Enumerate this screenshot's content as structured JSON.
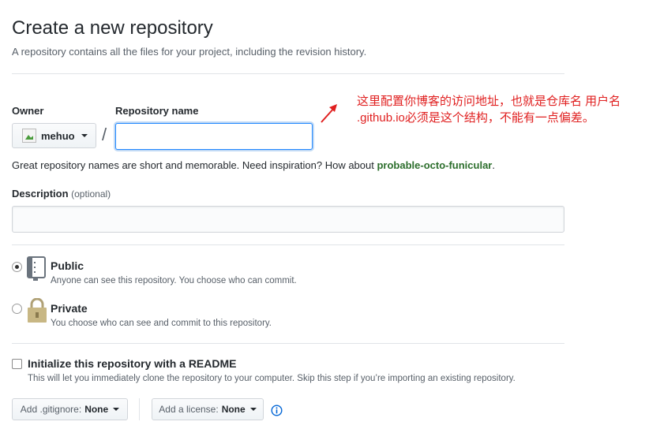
{
  "header": {
    "title": "Create a new repository",
    "subtitle": "A repository contains all the files for your project, including the revision history."
  },
  "owner": {
    "label": "Owner",
    "value": "mehuo"
  },
  "repo_name": {
    "label": "Repository name",
    "value": ""
  },
  "separator": "/",
  "annotation": {
    "line1": "这里配置你博客的访问地址，也就是仓库名 用户名",
    "line2": ".github.io必须是这个结构，不能有一点偏差。",
    "color": "#e02020"
  },
  "hint": {
    "text": "Great repository names are short and memorable. Need inspiration? How about ",
    "suggestion": "probable-octo-funicular",
    "end": "."
  },
  "description": {
    "label": "Description",
    "optional": "(optional)",
    "value": ""
  },
  "visibility": {
    "public": {
      "title": "Public",
      "note": "Anyone can see this repository. You choose who can commit.",
      "checked": true
    },
    "private": {
      "title": "Private",
      "note": "You choose who can see and commit to this repository.",
      "checked": false
    }
  },
  "readme": {
    "title": "Initialize this repository with a README",
    "note": "This will let you immediately clone the repository to your computer. Skip this step if you’re importing an existing repository.",
    "checked": false
  },
  "gitignore": {
    "label": "Add .gitignore:",
    "value": "None"
  },
  "license": {
    "label": "Add a license:",
    "value": "None"
  },
  "colors": {
    "accent_blue": "#0366d6",
    "suggestion_green": "#2c6e2c"
  }
}
